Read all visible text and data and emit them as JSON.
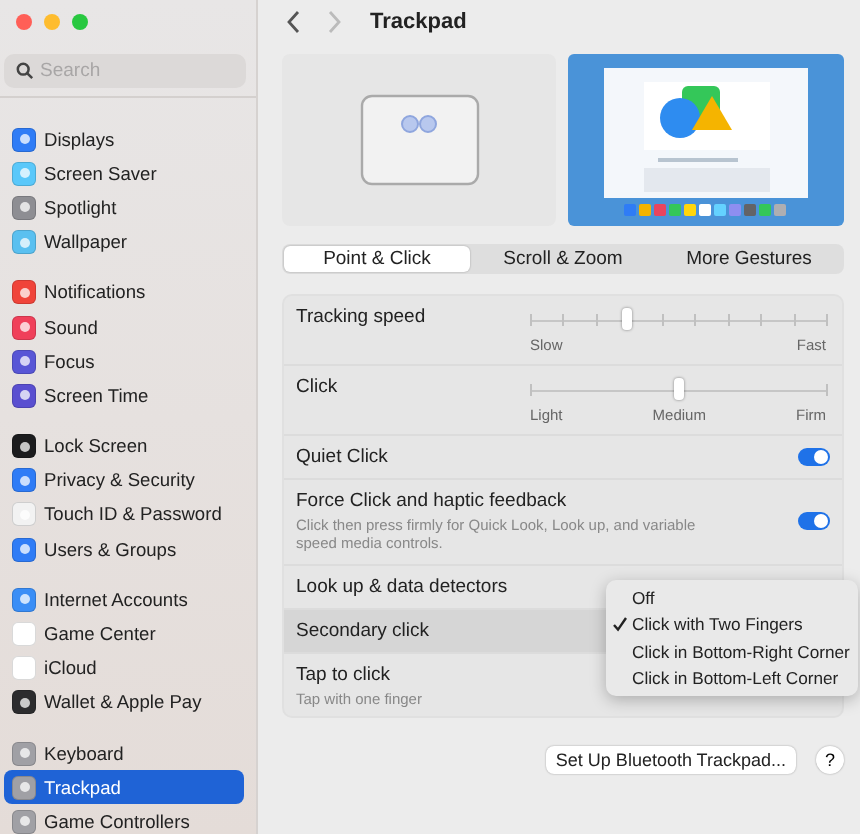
{
  "sidebar": {
    "search": {
      "placeholder": "Search"
    },
    "groups": [
      [
        {
          "label": "Displays",
          "color": "#2f7cf6",
          "selected": false
        },
        {
          "label": "Screen Saver",
          "color": "#5ac8fa",
          "selected": false
        },
        {
          "label": "Spotlight",
          "color": "#8e8e93",
          "selected": false
        },
        {
          "label": "Wallpaper",
          "color": "#5ac0f0",
          "selected": false
        }
      ],
      [
        {
          "label": "Notifications",
          "color": "#f0443a",
          "selected": false
        },
        {
          "label": "Sound",
          "color": "#f0405a",
          "selected": false
        },
        {
          "label": "Focus",
          "color": "#5856d6",
          "selected": false
        },
        {
          "label": "Screen Time",
          "color": "#5a4fd0",
          "selected": false
        }
      ],
      [
        {
          "label": "Lock Screen",
          "color": "#1c1c1e",
          "selected": false
        },
        {
          "label": "Privacy & Security",
          "color": "#2f7cf6",
          "selected": false
        },
        {
          "label": "Touch ID & Password",
          "color": "#f2f2f2",
          "selected": false
        },
        {
          "label": "Users & Groups",
          "color": "#2f7cf6",
          "selected": false
        }
      ],
      [
        {
          "label": "Internet Accounts",
          "color": "#3a8ef6",
          "selected": false
        },
        {
          "label": "Game Center",
          "color": "#ffffff",
          "selected": false
        },
        {
          "label": "iCloud",
          "color": "#ffffff",
          "selected": false
        },
        {
          "label": "Wallet & Apple Pay",
          "color": "#2c2c2e",
          "selected": false
        }
      ],
      [
        {
          "label": "Keyboard",
          "color": "#a0a0a5",
          "selected": false
        },
        {
          "label": "Trackpad",
          "color": "#a0a0a5",
          "selected": true
        },
        {
          "label": "Game Controllers",
          "color": "#a0a0a5",
          "selected": false
        }
      ]
    ]
  },
  "title": "Trackpad",
  "tabs": [
    {
      "label": "Point & Click",
      "selected": true
    },
    {
      "label": "Scroll & Zoom",
      "selected": false
    },
    {
      "label": "More Gestures",
      "selected": false
    }
  ],
  "rows": [
    {
      "kind": "slider",
      "label": "Tracking speed",
      "level": 0.33,
      "scale": [
        "Slow",
        "Fast"
      ],
      "highlighted": false
    },
    {
      "kind": "slider",
      "label": "Click",
      "level": 0.5,
      "scale": [
        "Light",
        "Medium",
        "Firm"
      ],
      "highlighted": false
    },
    {
      "kind": "toggle",
      "label": "Quiet Click",
      "on": true,
      "highlighted": false
    },
    {
      "kind": "toggle",
      "label": "Force Click and haptic feedback",
      "note": "Click then press firmly for Quick Look, Look up, and variable speed media controls.",
      "on": true,
      "highlighted": false
    },
    {
      "kind": "popup",
      "label": "Look up & data detectors",
      "highlighted": false
    },
    {
      "kind": "popup",
      "label": "Secondary click",
      "highlighted": true
    },
    {
      "kind": "text",
      "label": "Tap to click",
      "note": "Tap with one finger",
      "highlighted": false
    }
  ],
  "menu": [
    {
      "label": "Off",
      "checked": false
    },
    {
      "label": "Click with Two Fingers",
      "checked": true
    },
    {
      "label": "Click in Bottom-Right Corner",
      "checked": false
    },
    {
      "label": "Click in Bottom-Left Corner",
      "checked": false
    }
  ],
  "button": "Set Up Bluetooth Trackpad...",
  "help": "?"
}
